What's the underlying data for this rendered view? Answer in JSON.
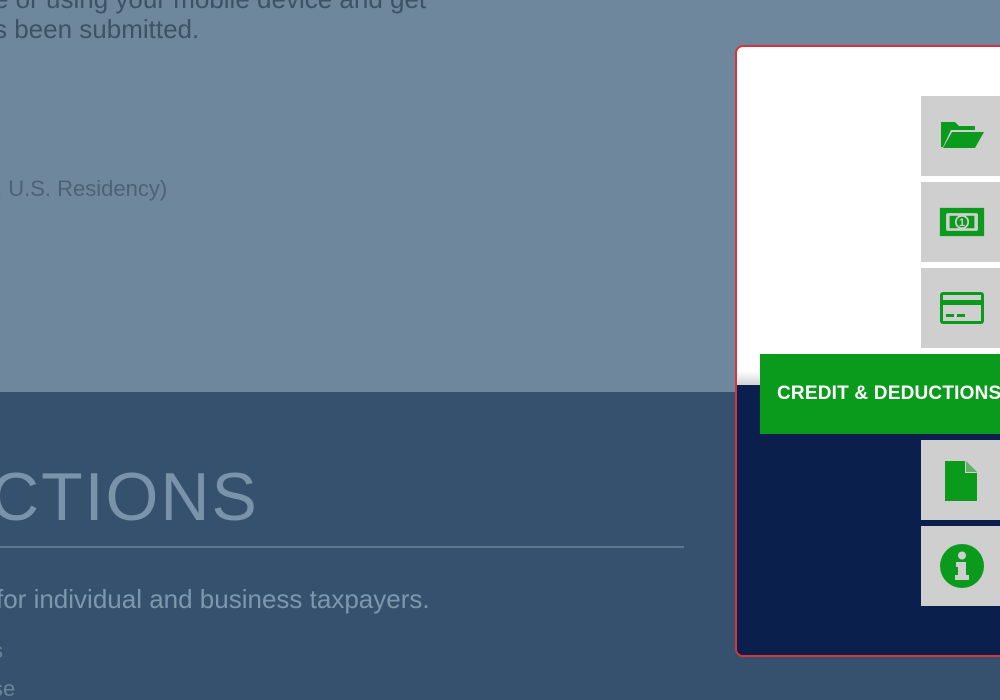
{
  "background": {
    "intro_line_1": "e or using your mobile device and get",
    "intro_line_2": "s been submitted.",
    "residency_note": ", U.S. Residency)",
    "section_heading": "CTIONS",
    "section_subtitle": "for individual and business taxpayers.",
    "list_item_1": "s",
    "list_item_2": "se"
  },
  "side_panel": {
    "active_tab_label": "CREDIT & DEDUCTIONS",
    "icons": [
      "folder-open-icon",
      "money-bill-icon",
      "credit-card-icon",
      "document-icon",
      "info-circle-icon"
    ],
    "colors": {
      "accent_green": "#0a9b1c",
      "tile_gray": "#cfcfcf",
      "panel_navy": "#0b1f4d",
      "panel_border": "#d9343c"
    }
  }
}
